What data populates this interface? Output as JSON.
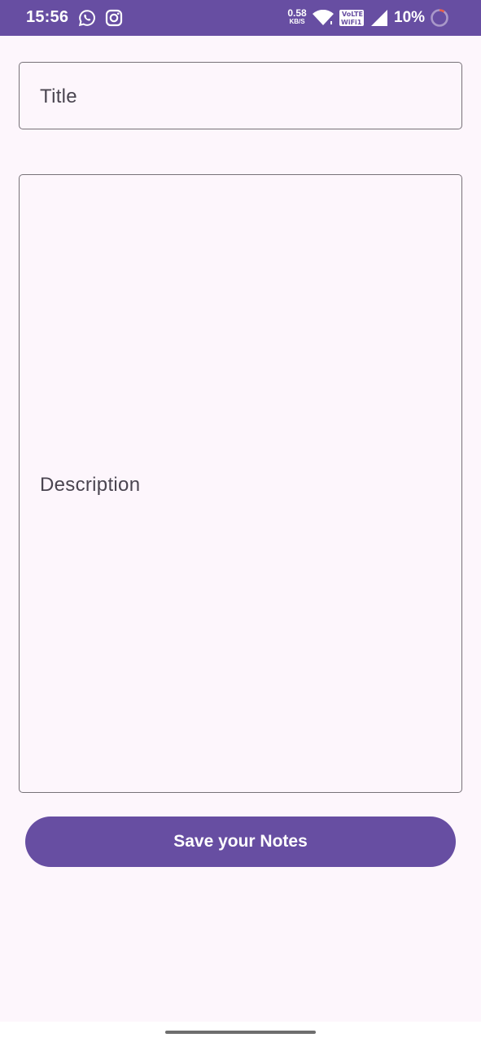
{
  "status_bar": {
    "time": "15:56",
    "network_speed_value": "0.58",
    "network_speed_unit": "KB/S",
    "battery_percent": "10%",
    "icons": [
      "whatsapp-icon",
      "instagram-icon",
      "wifi-icon",
      "vowifi-icon",
      "cell-signal-icon",
      "battery-ring-icon"
    ]
  },
  "form": {
    "title_placeholder": "Title",
    "description_placeholder": "Description"
  },
  "actions": {
    "save_label": "Save your Notes"
  },
  "colors": {
    "primary": "#674ea2",
    "background": "#fdf6fc",
    "outline": "#777278",
    "battery_low": "#e8604a"
  }
}
